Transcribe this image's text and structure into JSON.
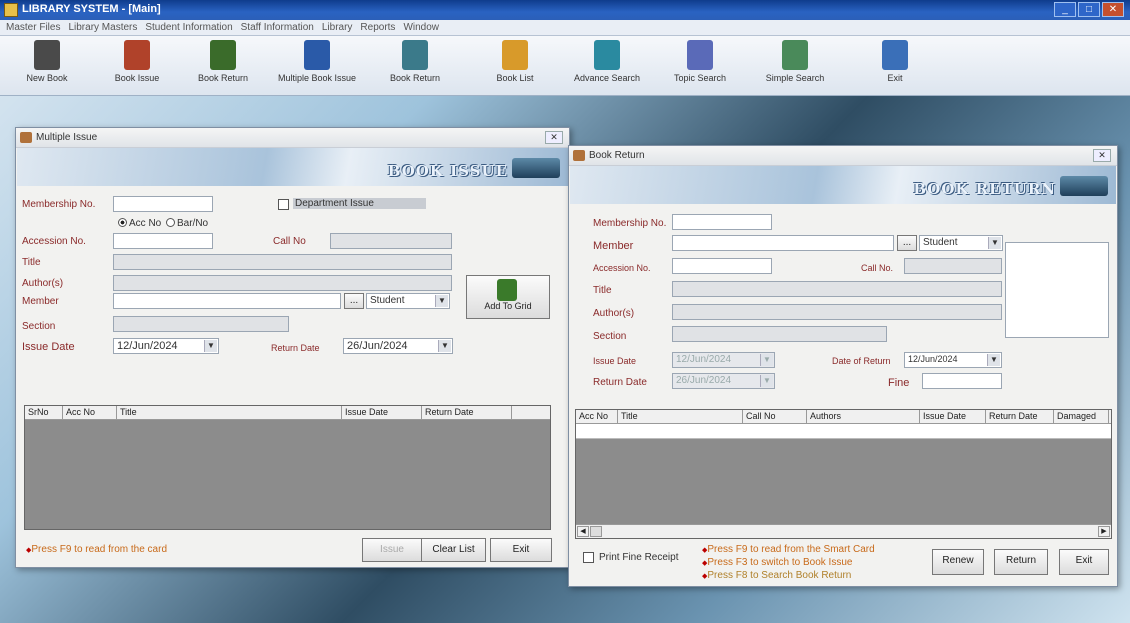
{
  "app": {
    "title": "LIBRARY SYSTEM - [Main]"
  },
  "menu": [
    "Master Files",
    "Library Masters",
    "Student Information",
    "Staff Information",
    "Library",
    "Reports",
    "Window"
  ],
  "toolbar": [
    {
      "label": "New Book",
      "icon": "new-book-icon",
      "color": "#4a4a4a"
    },
    {
      "label": "Book Issue",
      "icon": "book-issue-icon",
      "color": "#b0422a"
    },
    {
      "label": "Book Return",
      "icon": "book-return-icon",
      "color": "#3a6b2a"
    },
    {
      "label": "Multiple Book Issue",
      "icon": "multiple-book-issue-icon",
      "color": "#2a5aa8"
    },
    {
      "label": "Book Return",
      "icon": "book-return-2-icon",
      "color": "#3b7a8a"
    },
    {
      "label": "Book List",
      "icon": "book-list-icon",
      "color": "#d89a2a"
    },
    {
      "label": "Advance Search",
      "icon": "advance-search-icon",
      "color": "#2a8aa0"
    },
    {
      "label": "Topic Search",
      "icon": "topic-search-icon",
      "color": "#5a6ab8"
    },
    {
      "label": "Simple Search",
      "icon": "simple-search-icon",
      "color": "#4a8a5a"
    },
    {
      "label": "Exit",
      "icon": "exit-icon",
      "color": "#3a6fb8"
    }
  ],
  "issue": {
    "title": "Multiple Issue",
    "banner": "BOOK ISSUE",
    "membership_label": "Membership No.",
    "dept_issue_label": "Department Issue",
    "radio_acc": "Acc No",
    "radio_barcode": "Bar/No",
    "accession_label": "Accession No.",
    "callno_label": "Call No",
    "title_label": "Title",
    "authors_label": "Author(s)",
    "member_label": "Member",
    "member_type": "Student",
    "section_label": "Section",
    "issue_date_label": "Issue Date",
    "issue_date": "12/Jun/2024",
    "return_date_label": "Return Date",
    "return_date": "26/Jun/2024",
    "add_to_grid": "Add To Grid",
    "columns": [
      "SrNo",
      "Acc No",
      "Title",
      "Issue Date",
      "Return Date"
    ],
    "note": "Press F9 to read from the card",
    "btn_issue": "Issue",
    "btn_clear": "Clear List",
    "btn_exit": "Exit"
  },
  "return": {
    "title": "Book Return",
    "banner": "BOOK RETURN",
    "membership_label": "Membership No.",
    "member_label": "Member",
    "member_type": "Student",
    "accession_label": "Accession No.",
    "callno_label": "Call No.",
    "title_label": "Title",
    "authors_label": "Author(s)",
    "section_label": "Section",
    "issue_date_label": "Issue Date",
    "issue_date": "12/Jun/2024",
    "return_date_label": "Return Date",
    "return_date": "26/Jun/2024",
    "date_of_return_label": "Date of Return",
    "date_of_return": "12/Jun/2024",
    "fine_label": "Fine",
    "columns": [
      "Acc No",
      "Title",
      "Call No",
      "Authors",
      "Issue Date",
      "Return Date",
      "Damaged"
    ],
    "receipt_label": "Print Fine Receipt",
    "notes": [
      "Press F9 to read from the Smart Card",
      "Press F3 to switch to Book Issue",
      "Press F8 to Search Book Return"
    ],
    "btn_renew": "Renew",
    "btn_return": "Return",
    "btn_exit": "Exit"
  }
}
